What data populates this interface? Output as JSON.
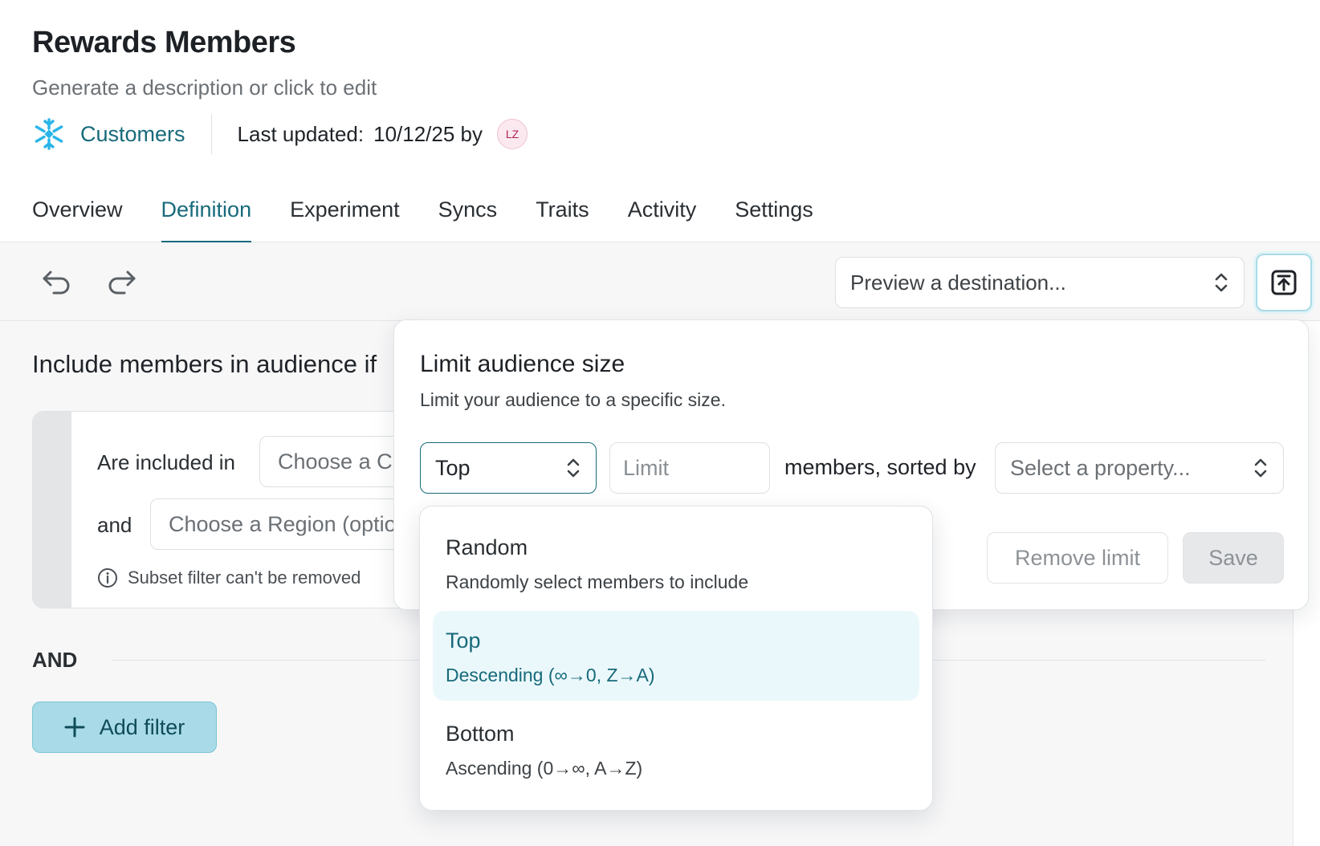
{
  "header": {
    "title": "Rewards Members",
    "description": "Generate a description or click to edit",
    "source_name": "Customers",
    "source_icon": "snowflake-icon",
    "last_updated_label": "Last updated:",
    "last_updated_value": "10/12/25 by",
    "avatar_initials": "LZ"
  },
  "tabs": [
    {
      "label": "Overview",
      "active": false
    },
    {
      "label": "Definition",
      "active": true
    },
    {
      "label": "Experiment",
      "active": false
    },
    {
      "label": "Syncs",
      "active": false
    },
    {
      "label": "Traits",
      "active": false
    },
    {
      "label": "Activity",
      "active": false
    },
    {
      "label": "Settings",
      "active": false
    }
  ],
  "toolbar": {
    "undo_icon": "undo-icon",
    "redo_icon": "redo-icon",
    "preview_placeholder": "Preview a destination...",
    "export_icon": "upload-icon"
  },
  "definition": {
    "include_heading": "Include members in audience if",
    "condition_label": "Are included in",
    "condition_placeholder": "Choose a C",
    "and_label": "and",
    "region_placeholder": "Choose a Region (optio",
    "subset_note": "Subset filter can't be removed",
    "and_divider": "AND",
    "add_filter_label": "Add filter"
  },
  "limit_popover": {
    "title": "Limit audience size",
    "subtitle": "Limit your audience to a specific size.",
    "order_value": "Top",
    "limit_placeholder": "Limit",
    "sorted_by_label": "members, sorted by",
    "property_placeholder": "Select a property...",
    "remove_label": "Remove limit",
    "save_label": "Save"
  },
  "order_options": [
    {
      "name": "Random",
      "description": "Randomly select members to include",
      "selected": false
    },
    {
      "name": "Top",
      "description": "Descending (∞→0, Z→A)",
      "selected": true
    },
    {
      "name": "Bottom",
      "description": "Ascending (0→∞, A→Z)",
      "selected": false
    }
  ],
  "colors": {
    "accent": "#176a7b",
    "add_filter_bg": "#a8dbe7",
    "selected_option_bg": "#ebf8fb",
    "snowflake": "#29b5e8"
  }
}
